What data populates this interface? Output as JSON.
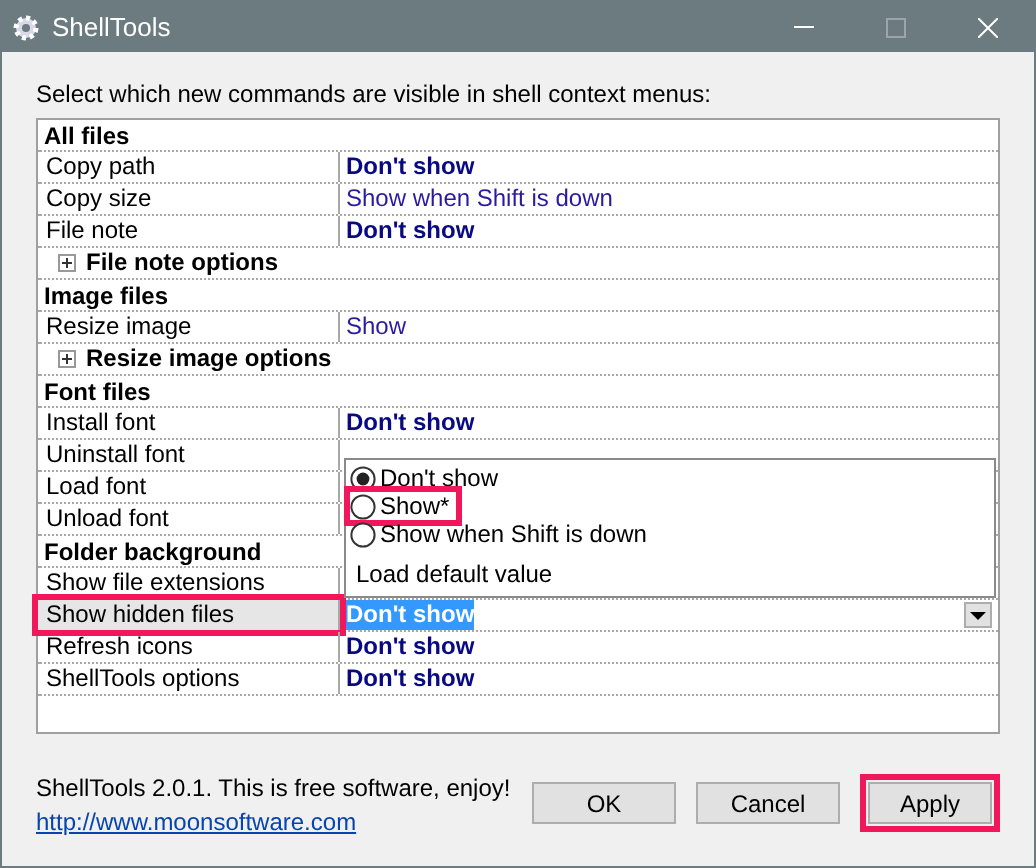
{
  "window": {
    "title": "ShellTools"
  },
  "instruction": "Select which new commands are visible in shell context menus:",
  "rows": [
    {
      "kind": "group",
      "label": "All files"
    },
    {
      "kind": "item",
      "label": "Copy path",
      "value": "Don't show",
      "bold": true,
      "editing": false,
      "highlighted": false
    },
    {
      "kind": "item",
      "label": "Copy size",
      "value": "Show when Shift is down",
      "bold": false,
      "editing": false,
      "highlighted": false
    },
    {
      "kind": "item",
      "label": "File note",
      "value": "Don't show",
      "bold": true,
      "editing": false,
      "highlighted": false
    },
    {
      "kind": "options",
      "label": "File note options"
    },
    {
      "kind": "group",
      "label": "Image files"
    },
    {
      "kind": "item",
      "label": "Resize image",
      "value": "Show",
      "bold": false,
      "editing": false,
      "highlighted": false
    },
    {
      "kind": "options",
      "label": "Resize image options"
    },
    {
      "kind": "group",
      "label": "Font files"
    },
    {
      "kind": "item",
      "label": "Install font",
      "value": "Don't show",
      "bold": true,
      "editing": false,
      "highlighted": false
    },
    {
      "kind": "item",
      "label": "Uninstall font",
      "editing": false,
      "highlighted": false
    },
    {
      "kind": "item",
      "label": "Load font",
      "editing": false,
      "highlighted": false
    },
    {
      "kind": "item",
      "label": "Unload font",
      "editing": false,
      "highlighted": false
    },
    {
      "kind": "group",
      "label": "Folder background"
    },
    {
      "kind": "item",
      "label": "Show file extensions",
      "editing": false,
      "highlighted": false
    },
    {
      "kind": "item",
      "label": "Show hidden files",
      "value": "Don't show",
      "bold": true,
      "editing": true,
      "highlighted": true
    },
    {
      "kind": "item",
      "label": "Refresh icons",
      "value": "Don't show",
      "bold": true,
      "editing": false,
      "highlighted": false
    },
    {
      "kind": "item",
      "label": "ShellTools options",
      "value": "Don't show",
      "bold": true,
      "editing": false,
      "highlighted": false
    }
  ],
  "dropdown": {
    "options": [
      {
        "label": "Don't show",
        "selected": true,
        "highlighted": false
      },
      {
        "label": "Show*",
        "selected": false,
        "highlighted": true
      },
      {
        "label": "Show when Shift is down",
        "selected": false,
        "highlighted": false
      }
    ],
    "action": "Load default value"
  },
  "footer": {
    "text": "ShellTools 2.0.1. This is free software, enjoy!",
    "link": "http://www.moonsoftware.com"
  },
  "buttons": [
    {
      "label": "OK",
      "highlighted": false
    },
    {
      "label": "Cancel",
      "highlighted": false
    },
    {
      "label": "Apply",
      "highlighted": true
    }
  ]
}
